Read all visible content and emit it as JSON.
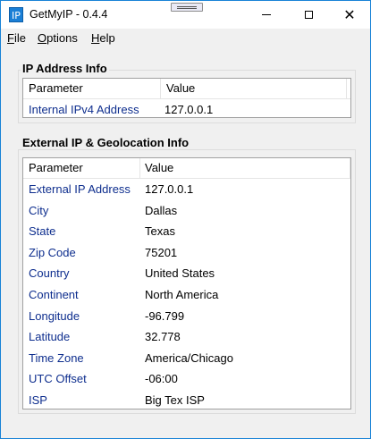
{
  "window": {
    "icon_text": "IP",
    "title": "GetMyIP - 0.4.4"
  },
  "menu": {
    "file": {
      "accel": "F",
      "rest": "ile"
    },
    "options": {
      "accel": "O",
      "rest": "ptions"
    },
    "help": {
      "accel": "H",
      "rest": "elp"
    }
  },
  "ip_group": {
    "title": "IP Address Info",
    "columns": [
      "Parameter",
      "Value"
    ],
    "rows": [
      {
        "param": "Internal IPv4 Address",
        "value": "127.0.0.1"
      }
    ]
  },
  "geo_group": {
    "title": "External IP & Geolocation Info",
    "columns": [
      "Parameter",
      "Value"
    ],
    "rows": [
      {
        "param": "External IP Address",
        "value": "127.0.0.1"
      },
      {
        "param": "City",
        "value": "Dallas"
      },
      {
        "param": "State",
        "value": "Texas"
      },
      {
        "param": "Zip Code",
        "value": "75201"
      },
      {
        "param": "Country",
        "value": "United States"
      },
      {
        "param": "Continent",
        "value": "North America"
      },
      {
        "param": "Longitude",
        "value": "-96.799"
      },
      {
        "param": "Latitude",
        "value": "32.778"
      },
      {
        "param": "Time Zone",
        "value": "America/Chicago"
      },
      {
        "param": "UTC Offset",
        "value": "-06:00"
      },
      {
        "param": "ISP",
        "value": "Big Tex ISP"
      }
    ]
  },
  "colors": {
    "window_border": "#1883d7",
    "param_text": "#0e2e8e",
    "background": "#f0f0f0"
  }
}
